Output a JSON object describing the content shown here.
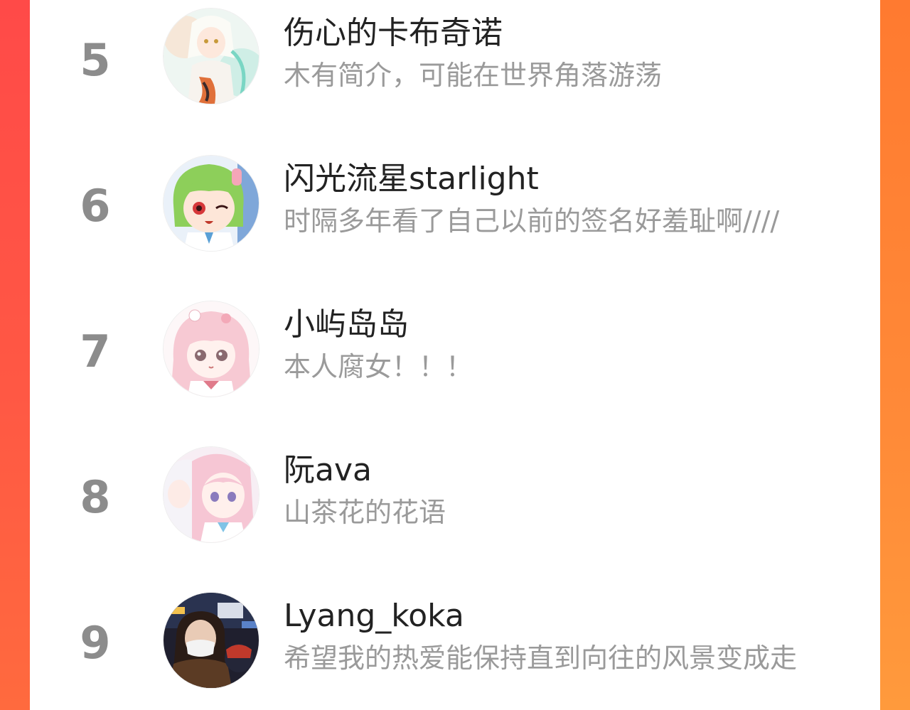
{
  "ranking": {
    "items": [
      {
        "rank": "5",
        "name": "伤心的卡布奇诺",
        "bio": "木有简介，可能在世界角落游荡",
        "avatar_icon": "anime-girl-white-hair-avatar-icon"
      },
      {
        "rank": "6",
        "name": "闪光流星starlight",
        "bio": "时隔多年看了自己以前的签名好羞耻啊////",
        "avatar_icon": "anime-girl-green-hair-avatar-icon"
      },
      {
        "rank": "7",
        "name": "小屿岛岛",
        "bio": "本人腐女！！！",
        "avatar_icon": "anime-girl-pink-hair-avatar-icon"
      },
      {
        "rank": "8",
        "name": "阮ava",
        "bio": "山茶花的花语",
        "avatar_icon": "anime-girls-pink-white-avatar-icon"
      },
      {
        "rank": "9",
        "name": "Lyang_koka",
        "bio": "希望我的热爱能保持直到向往的风景变成走",
        "avatar_icon": "photo-person-masked-avatar-icon"
      }
    ]
  },
  "colors": {
    "background_left": "#ff4a48",
    "background_right": "#ff8a38",
    "rank_number": "#8c8c8c",
    "name_text": "#222222",
    "bio_text": "#9a9a9a"
  }
}
